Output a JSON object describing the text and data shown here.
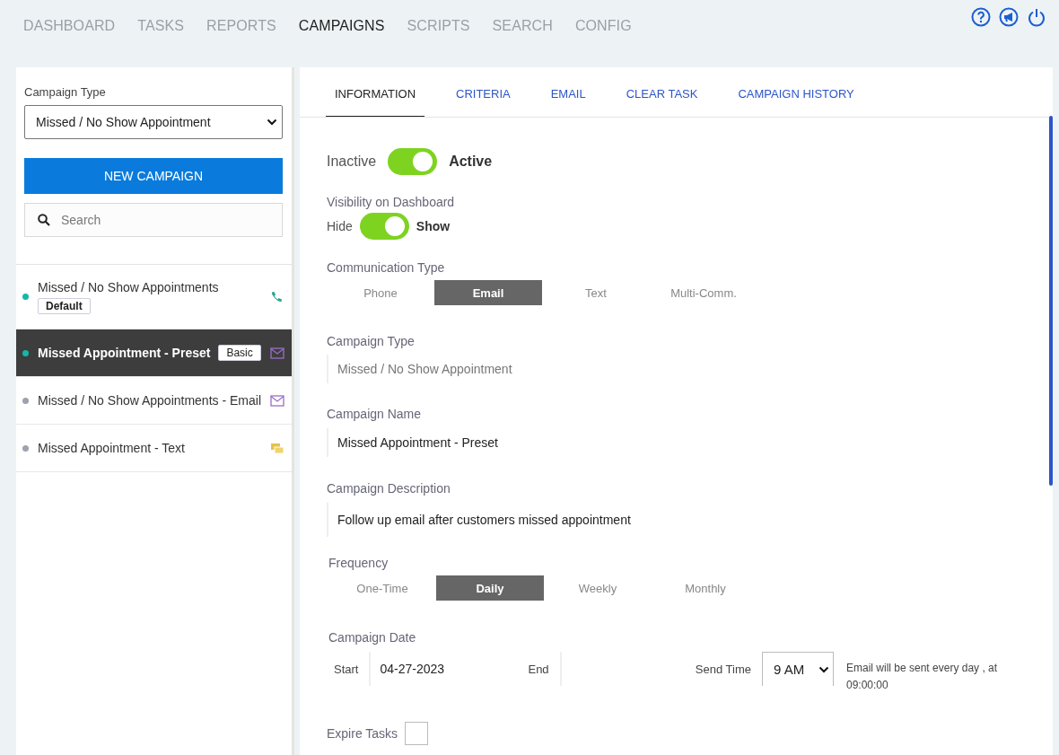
{
  "nav": [
    {
      "label": "DASHBOARD",
      "selected": false
    },
    {
      "label": "TASKS",
      "selected": false
    },
    {
      "label": "REPORTS",
      "selected": false
    },
    {
      "label": "CAMPAIGNS",
      "selected": true
    },
    {
      "label": "SCRIPTS",
      "selected": false
    },
    {
      "label": "SEARCH",
      "selected": false
    },
    {
      "label": "CONFIG",
      "selected": false
    }
  ],
  "sidebar": {
    "campaign_type_label": "Campaign Type",
    "campaign_type_value": "Missed / No Show Appointment",
    "new_campaign_button": "NEW CAMPAIGN",
    "search_placeholder": "Search",
    "campaigns": [
      {
        "name": "Missed / No Show Appointments",
        "badge": "Default",
        "color": "#14b8a6",
        "kind": "phone",
        "selected": false
      },
      {
        "name": "Missed Appointment - Preset",
        "badge": "Basic",
        "color": "#14b8a6",
        "kind": "email",
        "selected": true
      },
      {
        "name": "Missed / No Show Appointments - Email",
        "color": "#9ca3af",
        "kind": "email",
        "selected": false
      },
      {
        "name": "Missed Appointment - Text",
        "color": "#9ca3af",
        "kind": "text",
        "selected": false
      }
    ]
  },
  "tabs": [
    {
      "label": "INFORMATION",
      "selected": true
    },
    {
      "label": "CRITERIA",
      "selected": false
    },
    {
      "label": "EMAIL",
      "selected": false
    },
    {
      "label": "CLEAR TASK",
      "selected": false
    },
    {
      "label": "CAMPAIGN HISTORY",
      "selected": false
    }
  ],
  "form": {
    "status": {
      "off_label": "Inactive",
      "on_label": "Active",
      "on": true
    },
    "visibility": {
      "label": "Visibility on Dashboard",
      "off_label": "Hide",
      "on_label": "Show",
      "on": true
    },
    "communication": {
      "label": "Communication Type",
      "options": [
        {
          "label": "Phone",
          "selected": false
        },
        {
          "label": "Email",
          "selected": true
        },
        {
          "label": "Text",
          "selected": false
        },
        {
          "label": "Multi-Comm.",
          "selected": false
        }
      ]
    },
    "campaign_type": {
      "label": "Campaign Type",
      "value": "Missed / No Show Appointment"
    },
    "campaign_name": {
      "label": "Campaign Name",
      "value": "Missed Appointment - Preset"
    },
    "campaign_description": {
      "label": "Campaign Description",
      "value": "Follow up email after customers missed appointment"
    },
    "frequency": {
      "label": "Frequency",
      "options": [
        {
          "label": "One-Time",
          "selected": false
        },
        {
          "label": "Daily",
          "selected": true
        },
        {
          "label": "Weekly",
          "selected": false
        },
        {
          "label": "Monthly",
          "selected": false
        }
      ]
    },
    "campaign_date": {
      "label": "Campaign Date",
      "start_label": "Start",
      "start_value": "04-27-2023",
      "end_label": "End"
    },
    "send_time": {
      "label": "Send Time",
      "value": "9 AM",
      "note": "Email will be sent every day , at 09:00:00"
    },
    "expire_tasks": {
      "label": "Expire Tasks",
      "checked": false
    }
  }
}
